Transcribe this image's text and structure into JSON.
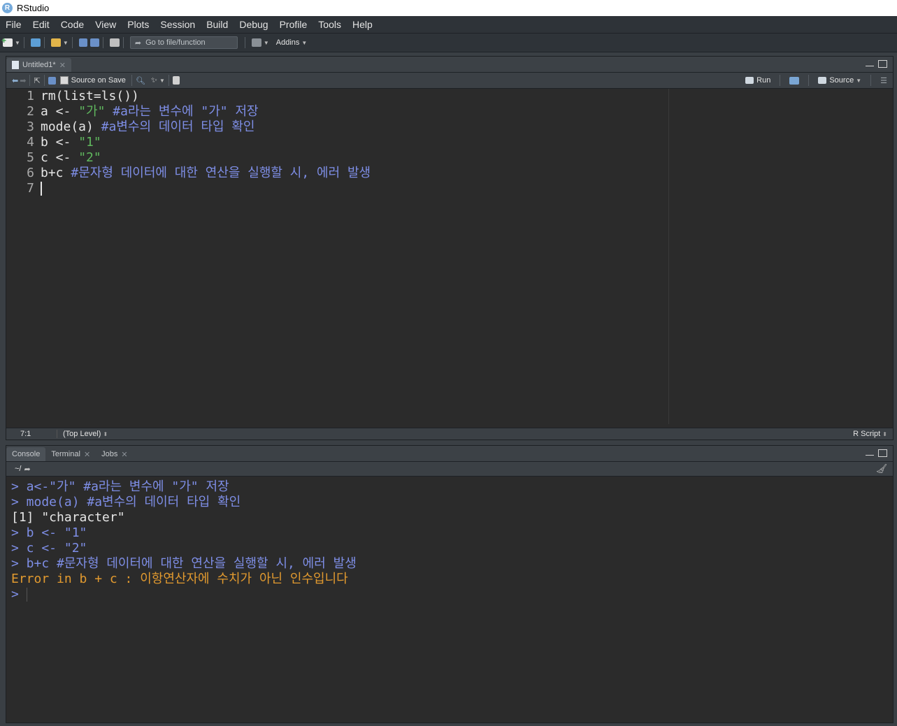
{
  "window": {
    "title": "RStudio",
    "logo": "R"
  },
  "menu": [
    "File",
    "Edit",
    "Code",
    "View",
    "Plots",
    "Session",
    "Build",
    "Debug",
    "Profile",
    "Tools",
    "Help"
  ],
  "toolbar": {
    "goto_placeholder": "Go to file/function",
    "addins_label": "Addins"
  },
  "editor": {
    "tab_label": "Untitled1*",
    "source_on_save_label": "Source on Save",
    "run_label": "Run",
    "source_label": "Source",
    "line_numbers": [
      "1",
      "2",
      "3",
      "4",
      "5",
      "6",
      "7"
    ],
    "lines": [
      {
        "code": "rm(list=ls())",
        "string": "",
        "code2": "",
        "comment": ""
      },
      {
        "code": "a <- ",
        "string": "\"가\"",
        "code2": " ",
        "comment": "#a라는 변수에 \"가\" 저장"
      },
      {
        "code": "mode(a) ",
        "string": "",
        "code2": "",
        "comment": "#a변수의 데이터 타입 확인"
      },
      {
        "code": "b <- ",
        "string": "\"1\"",
        "code2": "",
        "comment": ""
      },
      {
        "code": "c <- ",
        "string": "\"2\"",
        "code2": "",
        "comment": ""
      },
      {
        "code": "b+c ",
        "string": "",
        "code2": "",
        "comment": "#문자형 데이터에 대한 연산을 실행할 시, 에러 발생"
      },
      {
        "code": "",
        "string": "",
        "code2": "",
        "comment": ""
      }
    ],
    "status_position": "7:1",
    "status_level": "(Top Level)",
    "status_type": "R Script"
  },
  "console": {
    "tabs": [
      "Console",
      "Terminal",
      "Jobs"
    ],
    "path": "~/",
    "lines": [
      {
        "type": "in",
        "text": "> a<-\"가\" #a라는 변수에 \"가\" 저장"
      },
      {
        "type": "in",
        "text": "> mode(a) #a변수의 데이터 타입 확인"
      },
      {
        "type": "out",
        "text": "[1] \"character\""
      },
      {
        "type": "in",
        "text": "> b <- \"1\""
      },
      {
        "type": "in",
        "text": "> c <- \"2\""
      },
      {
        "type": "in",
        "text": "> b+c #문자형 데이터에 대한 연산을 실행할 시, 에러 발생"
      },
      {
        "type": "err",
        "text": "Error in b + c : 이항연산자에 수치가 아닌 인수입니다"
      },
      {
        "type": "in",
        "text": "> "
      }
    ]
  },
  "colors": {
    "comment": "#7e8ee6",
    "string": "#60b85e",
    "error": "#e29a2f",
    "background": "#2b2b2b"
  }
}
